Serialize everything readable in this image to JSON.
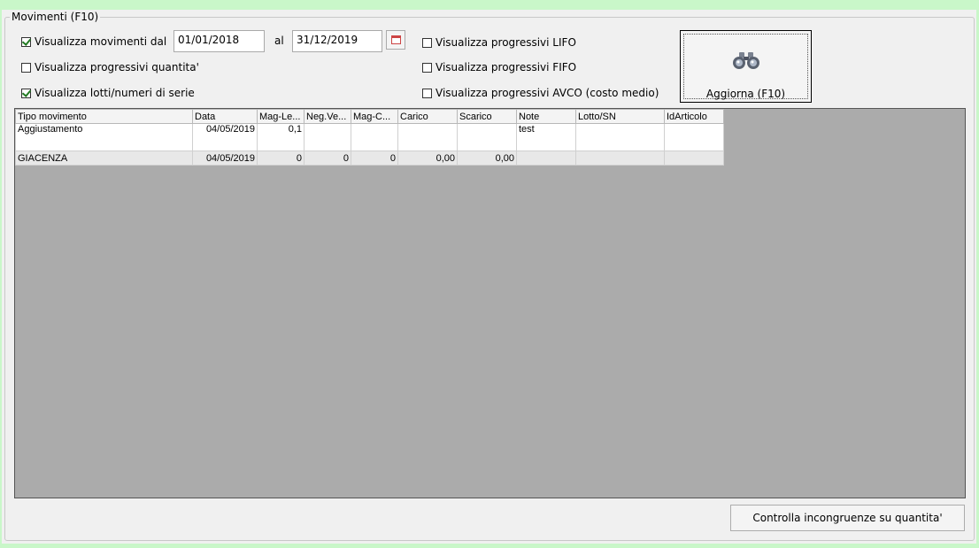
{
  "group": {
    "title": "Movimenti (F10)"
  },
  "filters": {
    "show_movements": {
      "label": "Visualizza movimenti dal",
      "checked": true
    },
    "date_from": "01/01/2018",
    "date_to_label": "al",
    "date_to": "31/12/2019",
    "progressivi_quantita": {
      "label": "Visualizza progressivi quantita'",
      "checked": false
    },
    "lotti": {
      "label": "Visualizza lotti/numeri di serie",
      "checked": true
    },
    "lifo": {
      "label": "Visualizza progressivi LIFO",
      "checked": false
    },
    "fifo": {
      "label": "Visualizza progressivi FIFO",
      "checked": false
    },
    "avco": {
      "label": "Visualizza progressivi AVCO (costo medio)",
      "checked": false
    }
  },
  "refresh_button": {
    "label": "Aggiorna (F10)",
    "icon": "binoculars-icon"
  },
  "table": {
    "columns": [
      "Tipo movimento",
      "Data",
      "Mag-Le...",
      "Neg.Ve...",
      "Mag-C...",
      "Carico",
      "Scarico",
      "Note",
      "Lotto/SN",
      "IdArticolo"
    ],
    "rows": [
      [
        "Aggiustamento",
        "04/05/2019",
        "0,1",
        "",
        "",
        "",
        "",
        "test",
        "",
        ""
      ],
      [
        "GIACENZA",
        "04/05/2019",
        "0",
        "0",
        "0",
        "0,00",
        "0,00",
        "",
        "",
        ""
      ]
    ]
  },
  "check_button": {
    "label": "Controlla incongruenze su quantita'"
  }
}
